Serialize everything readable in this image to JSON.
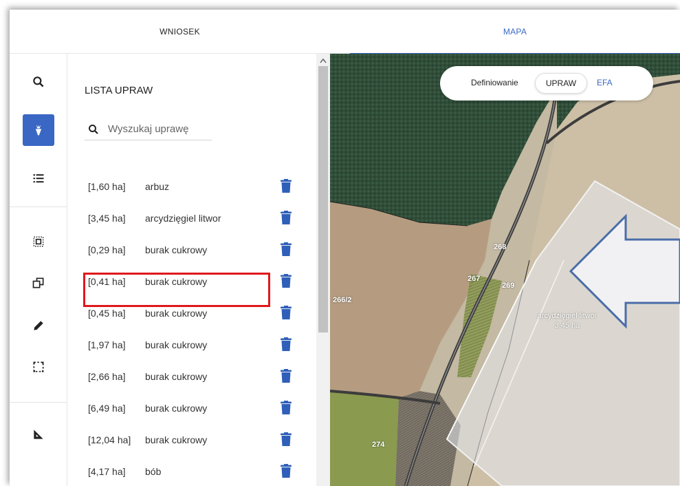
{
  "tabs": {
    "wniosek": "WNIOSEK",
    "mapa": "MAPA"
  },
  "iconbar": {
    "icons": [
      "search-icon",
      "crop-beet-icon",
      "list-icon",
      "select-region-icon",
      "copy-shape-icon",
      "pencil-icon",
      "dashed-rectangle-icon",
      "ruler-triangle-icon"
    ],
    "active_color": "#3a67c4"
  },
  "panel": {
    "title": "LISTA UPRAW",
    "search_placeholder": "Wyszukaj uprawę"
  },
  "crops": [
    {
      "area": "[1,60 ha]",
      "name": "arbuz"
    },
    {
      "area": "[3,45 ha]",
      "name": "arcydzięgiel litwor"
    },
    {
      "area": "[0,29 ha]",
      "name": "burak cukrowy"
    },
    {
      "area": "[0,41 ha]",
      "name": "burak cukrowy"
    },
    {
      "area": "[0,45 ha]",
      "name": "burak cukrowy"
    },
    {
      "area": "[1,97 ha]",
      "name": "burak cukrowy"
    },
    {
      "area": "[2,66 ha]",
      "name": "burak cukrowy"
    },
    {
      "area": "[6,49 ha]",
      "name": "burak cukrowy"
    },
    {
      "area": "[12,04 ha]",
      "name": "burak cukrowy"
    },
    {
      "area": "[4,17 ha]",
      "name": "bób"
    }
  ],
  "map": {
    "toggle_label": "Definiowanie",
    "option_upraw": "UPRAW",
    "option_efa": "EFA",
    "parcel_numbers": {
      "p268": "268",
      "p267": "267",
      "p269": "269",
      "p266_2": "266/2",
      "p274": "274"
    },
    "parcel_crop": "arcydzięgiel litwor",
    "parcel_area": "3.45 ha"
  },
  "colors": {
    "accent": "#3a67c4",
    "highlight": "#e0171b",
    "delete_icon": "#2f5fb8"
  }
}
